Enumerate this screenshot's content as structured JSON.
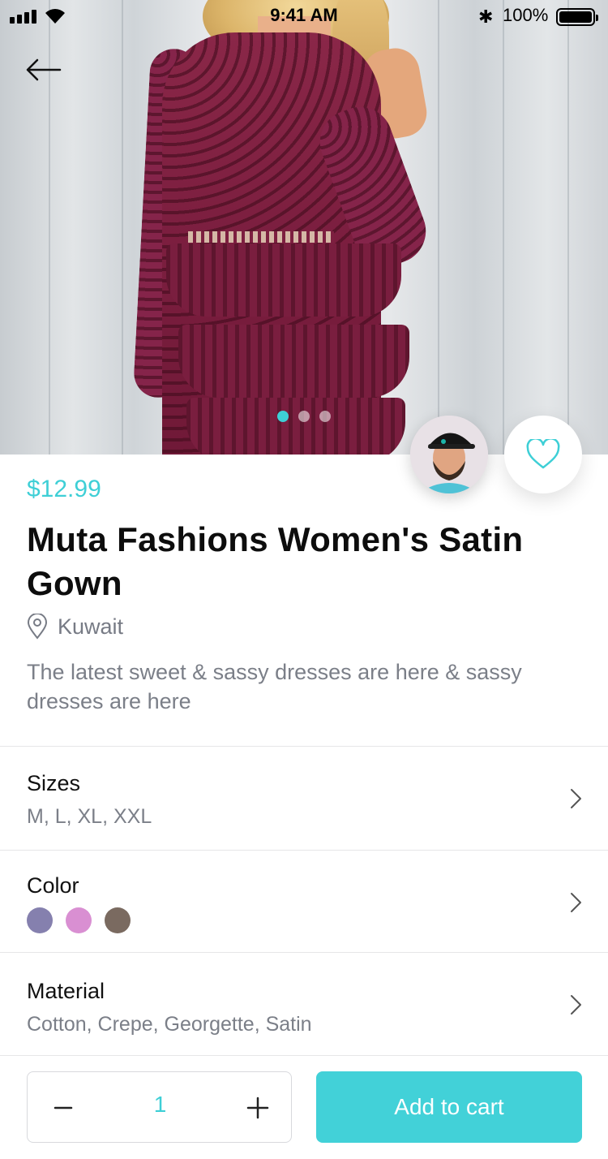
{
  "status_bar": {
    "time": "9:41 AM",
    "battery": "100%"
  },
  "product": {
    "price": "$12.99",
    "title": "Muta Fashions Women's Satin Gown",
    "location": "Kuwait",
    "description": "The latest sweet & sassy dresses are here & sassy dresses are here"
  },
  "carousel": {
    "count": 3,
    "active": 1
  },
  "options": {
    "sizes": {
      "label": "Sizes",
      "value": "M, L, XL, XXL"
    },
    "color": {
      "label": "Color",
      "swatches": [
        "#8580ae",
        "#d98fd2",
        "#7a6a60"
      ]
    },
    "material": {
      "label": "Material",
      "value": "Cotton, Crepe, Georgette, Satin"
    }
  },
  "cart": {
    "quantity": "1",
    "add_label": "Add to cart"
  },
  "icons": {
    "back": "arrow-left-icon",
    "favorite": "heart-icon",
    "location": "location-pin-icon",
    "chevron": "chevron-right-icon",
    "minus": "minus-icon",
    "plus": "plus-icon"
  },
  "colors": {
    "accent": "#3ecfd6",
    "muted_text": "#7b7f88"
  }
}
